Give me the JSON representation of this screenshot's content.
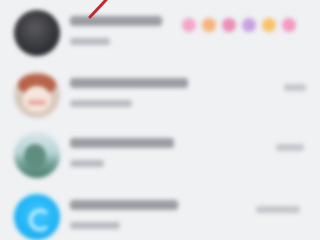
{
  "chat_list": {
    "rows": [
      {
        "avatar_icon": "dark-avatar-icon"
      },
      {
        "avatar_icon": "cartoon-girl-avatar-icon"
      },
      {
        "avatar_icon": "landscape-avatar-icon"
      },
      {
        "avatar_icon": "blue-app-avatar-icon"
      }
    ]
  },
  "colors": {
    "background": "#eff1f3",
    "annotation_arrow": "#c8272e",
    "blue_avatar": "#20b3f5"
  }
}
